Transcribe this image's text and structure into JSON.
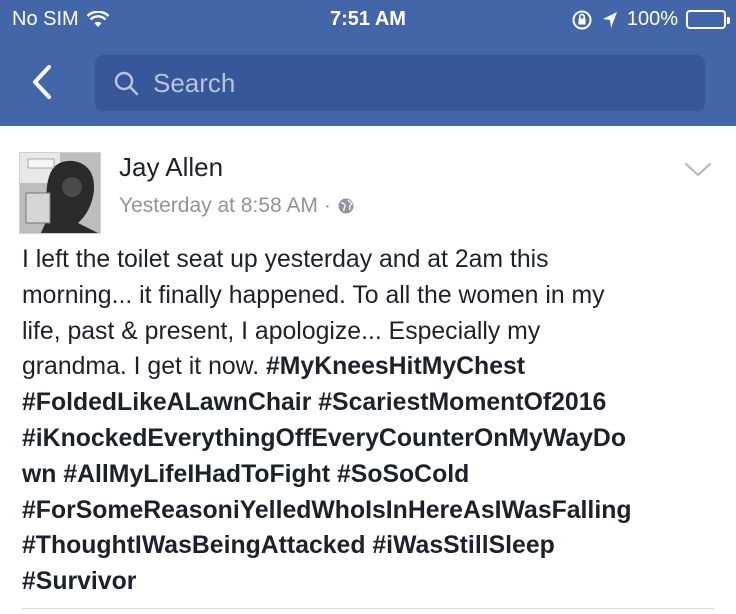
{
  "status_bar": {
    "carrier": "No SIM",
    "time": "7:51 AM",
    "battery_percent": "100%"
  },
  "nav": {
    "search_placeholder": "Search"
  },
  "post": {
    "author": "Jay Allen",
    "timestamp": "Yesterday at 8:58 AM",
    "separator": "·",
    "body": {
      "l1": "I left the toilet seat up yesterday and at 2am this",
      "l2": "morning... it finally happened. To all the women in my",
      "l3": "life, past & present, I apologize... Especially my",
      "l4a": "grandma. I get it now. ",
      "l4b": "#MyKneesHitMyChest",
      "l5a": "#FoldedLikeALawnChair",
      "l5b": "#ScariestMomentOf2016",
      "l6": "#iKnockedEverythingOffEveryCounterOnMyWayDo",
      "l7a": "wn",
      "l7b": "#AllMyLifeIHadToFight",
      "l7c": "#SoSoCold",
      "l8": "#ForSomeReasoniYelledWhoIsInHereAsIWasFalling",
      "l9a": "#ThoughtIWasBeingAttacked",
      "l9b": "#iWasStillSleep",
      "l10": "#Survivor"
    }
  },
  "colors": {
    "header_bg": "#4266a8",
    "search_bg": "#36579a",
    "meta_text": "#90949c"
  }
}
